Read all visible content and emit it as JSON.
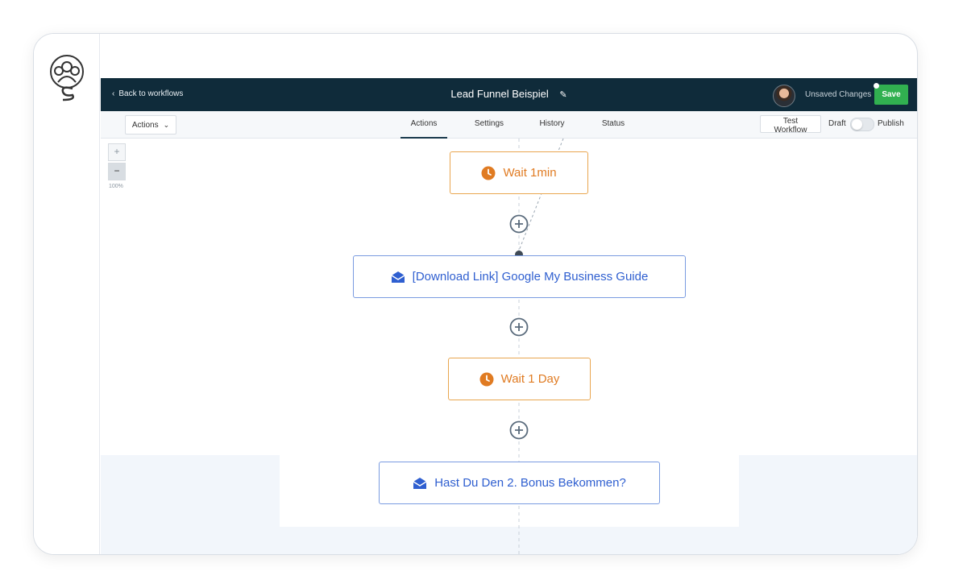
{
  "header": {
    "back_label": "Back to workflows",
    "workflow_name": "Lead Funnel Beispiel",
    "unsaved_label": "Unsaved Changes",
    "save_label": "Save"
  },
  "subbar": {
    "actions_label": "Actions",
    "tabs": [
      {
        "label": "Actions",
        "active": true
      },
      {
        "label": "Settings",
        "active": false
      },
      {
        "label": "History",
        "active": false
      },
      {
        "label": "Status",
        "active": false
      }
    ],
    "test_label": "Test Workflow",
    "draft_label": "Draft",
    "publish_label": "Publish",
    "published": false
  },
  "zoom": {
    "plus": "+",
    "minus": "−",
    "level": "100%"
  },
  "nodes": [
    {
      "type": "wait",
      "label": "Wait 1min",
      "icon": "clock-icon"
    },
    {
      "type": "email",
      "label": "[Download Link] Google My Business Guide",
      "icon": "mail-icon"
    },
    {
      "type": "wait",
      "label": "Wait 1 Day",
      "icon": "clock-icon"
    },
    {
      "type": "email",
      "label": "Hast Du Den 2. Bonus Bekommen?",
      "icon": "mail-icon"
    }
  ],
  "colors": {
    "topbar": "#0f2b3a",
    "save": "#31b050",
    "wait_border": "#e9a64f",
    "wait_text": "#e07b22",
    "email_border": "#7a9be0",
    "email_text": "#2f5fd0"
  }
}
